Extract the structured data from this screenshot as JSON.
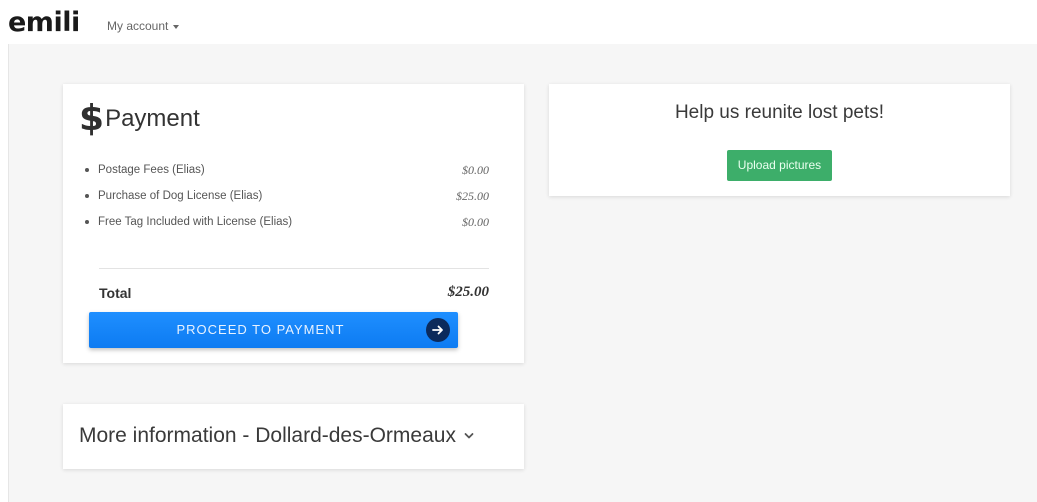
{
  "header": {
    "logo": "emili",
    "account_menu": "My account"
  },
  "payment": {
    "title": "Payment",
    "currency_symbol": "$",
    "items": [
      {
        "label": "Postage Fees (Elias)",
        "amount": "$0.00"
      },
      {
        "label": "Purchase of Dog License (Elias)",
        "amount": "$25.00"
      },
      {
        "label": "Free Tag Included with License (Elias)",
        "amount": "$0.00"
      }
    ],
    "total_label": "Total",
    "total_amount": "$25.00",
    "proceed_label": "PROCEED TO PAYMENT"
  },
  "more_info": {
    "title": "More information - Dollard-des-Ormeaux"
  },
  "help": {
    "title": "Help us reunite lost pets!",
    "upload_label": "Upload pictures"
  },
  "colors": {
    "primary_button": "#1586f8",
    "success_button": "#3dae6a",
    "page_background": "#f6f6f6"
  }
}
